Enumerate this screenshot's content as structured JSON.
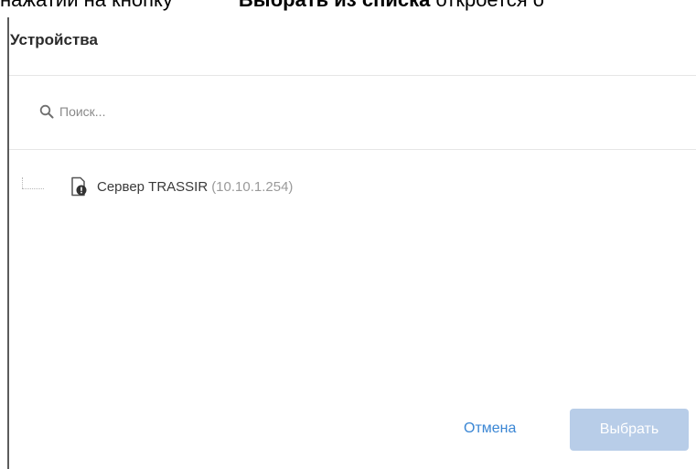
{
  "document": {
    "fragment_start": "нажатии на кнопку",
    "fragment_bold": "Выбрать из списка",
    "fragment_end": "откроется о"
  },
  "dialog": {
    "title": "Устройства",
    "search": {
      "placeholder": "Поиск...",
      "value": ""
    },
    "tree": [
      {
        "name": "Сервер TRASSIR",
        "ip": "(10.10.1.254)",
        "icon": "server-warning-icon"
      }
    ],
    "buttons": {
      "cancel": "Отмена",
      "select": "Выбрать"
    }
  },
  "colors": {
    "accent": "#3a86d4",
    "button_disabled": "#b8cde8",
    "divider": "#e6e6e6",
    "secondary_text": "#9a9a9a"
  }
}
